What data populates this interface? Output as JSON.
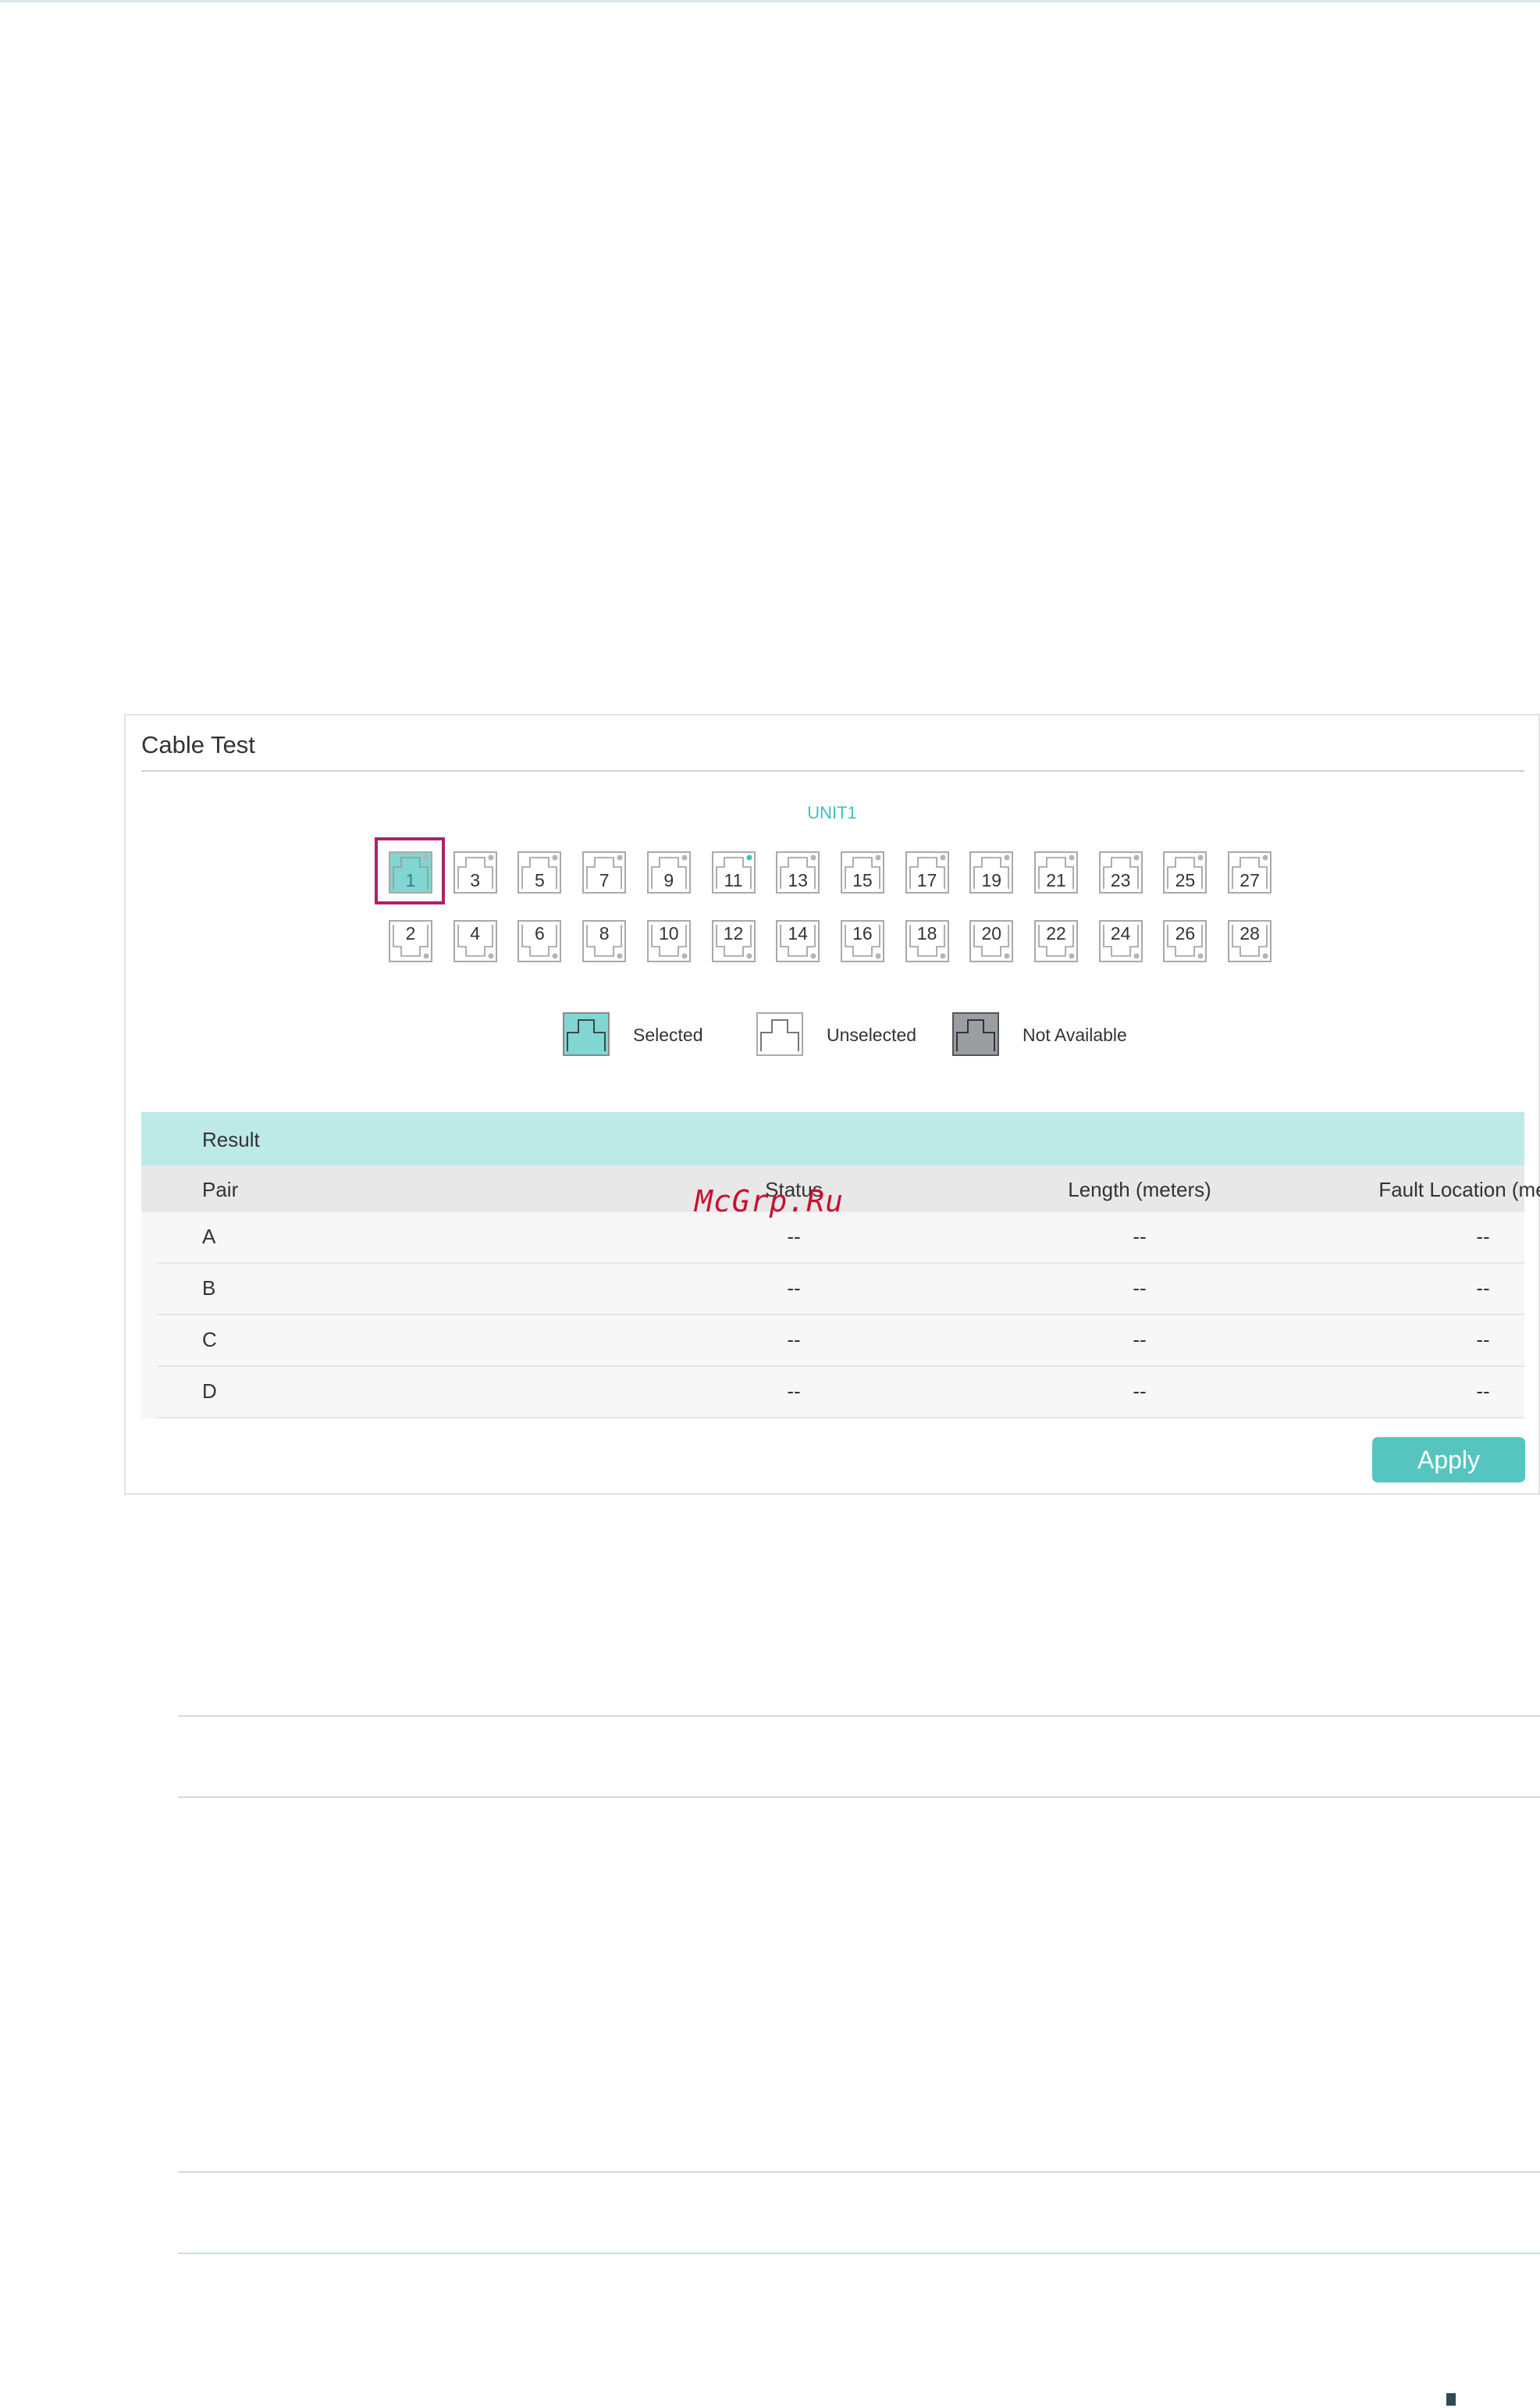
{
  "panel": {
    "title": "Cable Test",
    "unit_label": "UNIT1",
    "selected_port": "1",
    "ports_top": [
      "1",
      "3",
      "5",
      "7",
      "9",
      "11",
      "13",
      "15",
      "17",
      "19",
      "21",
      "23",
      "25",
      "27"
    ],
    "ports_bottom": [
      "2",
      "4",
      "6",
      "8",
      "10",
      "12",
      "14",
      "16",
      "18",
      "20",
      "22",
      "24",
      "26",
      "28"
    ],
    "linked_port": "11"
  },
  "legend": {
    "selected": "Selected",
    "unselected": "Unselected",
    "not_available": "Not Available"
  },
  "result": {
    "title": "Result",
    "columns": [
      "Pair",
      "Status",
      "Length (meters)",
      "Fault Location (meters)"
    ],
    "rows": [
      {
        "pair": "A",
        "status": "--",
        "length": "--",
        "fault": "--"
      },
      {
        "pair": "B",
        "status": "--",
        "length": "--",
        "fault": "--"
      },
      {
        "pair": "C",
        "status": "--",
        "length": "--",
        "fault": "--"
      },
      {
        "pair": "D",
        "status": "--",
        "length": "--",
        "fault": "--"
      }
    ]
  },
  "apply_label": "Apply",
  "watermark": "McGrp.Ru",
  "colors": {
    "accent": "#56c5c0",
    "selected_port": "#7fd6d2",
    "selection_frame": "#b0226b",
    "result_header": "#bde9e6",
    "not_available": "#9a9ea3"
  }
}
